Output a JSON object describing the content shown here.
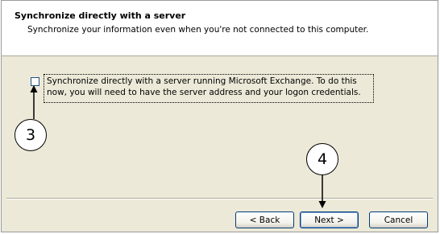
{
  "header": {
    "title": "Synchronize directly with a server",
    "subtitle": "Synchronize your information even when you're not connected to this computer."
  },
  "option": {
    "checked": false,
    "label": "Synchronize directly with a server running Microsoft Exchange.  To do this now, you will need to have the server address and your logon credentials."
  },
  "buttons": {
    "back": "< Back",
    "next": "Next >",
    "cancel": "Cancel"
  },
  "callouts": {
    "checkbox_step": "3",
    "next_step": "4"
  }
}
